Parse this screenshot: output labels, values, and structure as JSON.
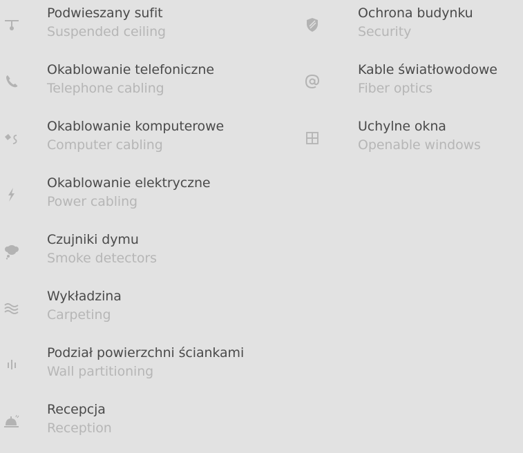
{
  "left_items": [
    {
      "icon": "ceiling-light-icon",
      "pl": "Podwieszany sufit",
      "en": "Suspended ceiling"
    },
    {
      "icon": "phone-icon",
      "pl": "Okablowanie telefoniczne",
      "en": "Telephone cabling"
    },
    {
      "icon": "plug-cable-icon",
      "pl": "Okablowanie komputerowe",
      "en": "Computer cabling"
    },
    {
      "icon": "lightning-icon",
      "pl": "Okablowanie elektryczne",
      "en": "Power cabling"
    },
    {
      "icon": "smoke-co-icon",
      "pl": "Czujniki dymu",
      "en": "Smoke detectors"
    },
    {
      "icon": "waves-icon",
      "pl": "Wykładzina",
      "en": "Carpeting"
    },
    {
      "icon": "partition-icon",
      "pl": "Podział powierzchni ściankami",
      "en": "Wall partitioning"
    },
    {
      "icon": "reception-bell-icon",
      "pl": "Recepcja",
      "en": "Reception"
    }
  ],
  "right_items": [
    {
      "icon": "shield-icon",
      "pl": "Ochrona budynku",
      "en": "Security"
    },
    {
      "icon": "at-sign-icon",
      "pl": "Kable światłowodowe",
      "en": "Fiber optics"
    },
    {
      "icon": "window-icon",
      "pl": "Uchylne okna",
      "en": "Openable windows"
    }
  ],
  "colors": {
    "background": "#e2e2e2",
    "primary_text": "#4a4a4a",
    "secondary_text": "#b6b6b6",
    "icon": "#b3b3b3"
  }
}
